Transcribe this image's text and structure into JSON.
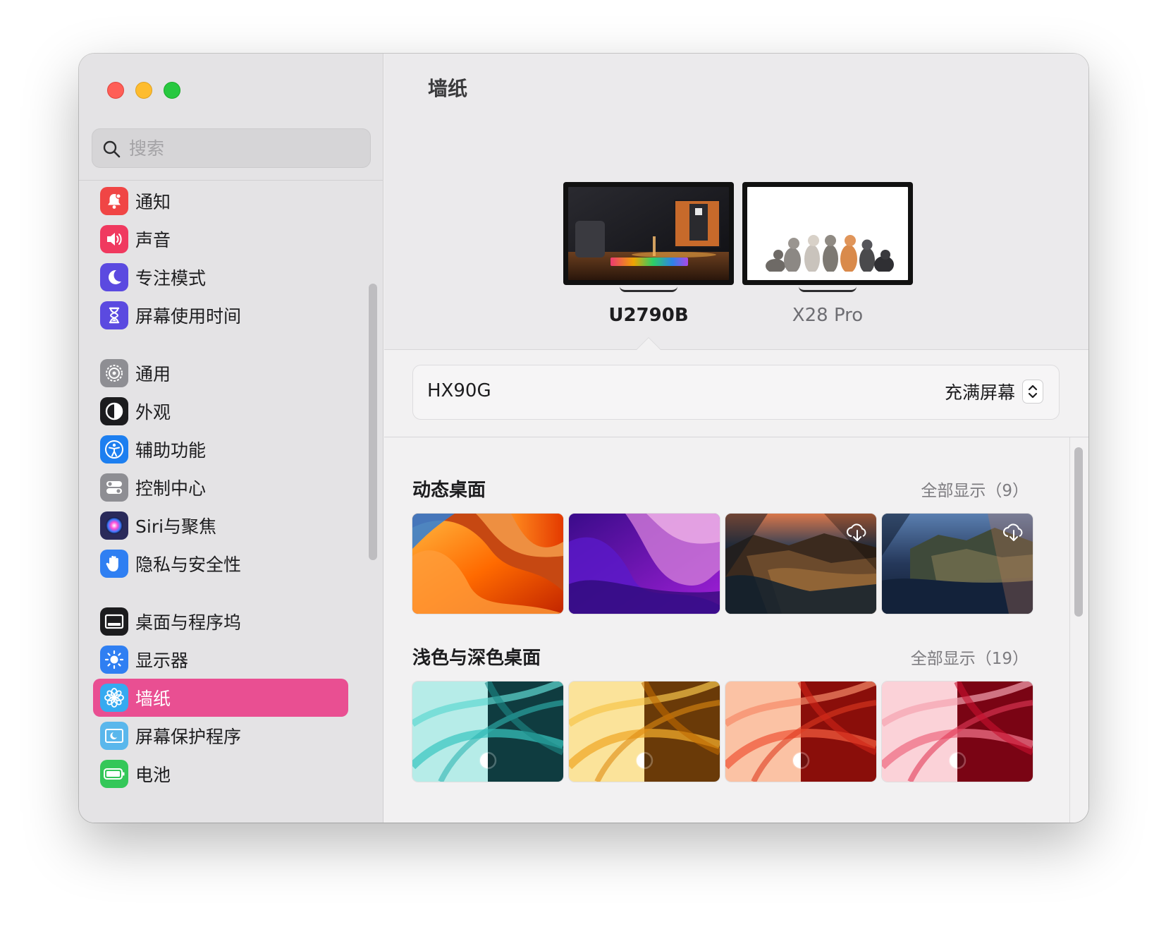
{
  "window": {
    "page_title": "墙纸"
  },
  "sidebar": {
    "search_placeholder": "搜索",
    "items": [
      {
        "label": "通知",
        "icon": "bell-icon",
        "color": "#f04545"
      },
      {
        "label": "声音",
        "icon": "speaker-icon",
        "color": "#f0395f"
      },
      {
        "label": "专注模式",
        "icon": "moon-icon",
        "color": "#5b4ae0"
      },
      {
        "label": "屏幕使用时间",
        "icon": "hourglass-icon",
        "color": "#5b4ae0"
      },
      {
        "label": "通用",
        "icon": "gear-icon",
        "color": "#8e8e93"
      },
      {
        "label": "外观",
        "icon": "appearance-icon",
        "color": "#1c1c1e"
      },
      {
        "label": "辅助功能",
        "icon": "accessibility-icon",
        "color": "#1d7ff0"
      },
      {
        "label": "控制中心",
        "icon": "toggles-icon",
        "color": "#8e8e93"
      },
      {
        "label": "Siri与聚焦",
        "icon": "siri-icon",
        "color": "#2a2a5a"
      },
      {
        "label": "隐私与安全性",
        "icon": "hand-icon",
        "color": "#2f7ff2"
      },
      {
        "label": "桌面与程序坞",
        "icon": "dock-icon",
        "color": "#1c1c1e"
      },
      {
        "label": "显示器",
        "icon": "brightness-icon",
        "color": "#2f7ff2"
      },
      {
        "label": "墙纸",
        "icon": "flower-icon",
        "color": "#35aaf0",
        "active": true
      },
      {
        "label": "屏幕保护程序",
        "icon": "screensaver-icon",
        "color": "#5ab7ec"
      },
      {
        "label": "电池",
        "icon": "battery-icon",
        "color": "#34c759"
      }
    ]
  },
  "displays": [
    {
      "name": "U2790B",
      "selected": true
    },
    {
      "name": "X28 Pro",
      "selected": false
    }
  ],
  "current_wallpaper": {
    "name": "HX90G",
    "fit_mode": "充满屏幕"
  },
  "sections": [
    {
      "title": "动态桌面",
      "show_all": "全部显示（9）",
      "thumbnails": [
        {
          "name": "ventura-orange",
          "download": false
        },
        {
          "name": "monterey-purple",
          "download": false
        },
        {
          "name": "big-sur-coast",
          "download": true
        },
        {
          "name": "catalina-island",
          "download": true
        }
      ]
    },
    {
      "title": "浅色与深色桌面",
      "show_all": "全部显示（19）",
      "thumbnails": [
        {
          "name": "imac-teal",
          "download": false
        },
        {
          "name": "imac-yellow",
          "download": false
        },
        {
          "name": "imac-orange",
          "download": false
        },
        {
          "name": "imac-pink",
          "download": false
        }
      ]
    }
  ],
  "colors": {
    "accent": "#e94f92",
    "sidebar_bg": "#e4e3e5",
    "main_bg": "#f2f1f2"
  }
}
